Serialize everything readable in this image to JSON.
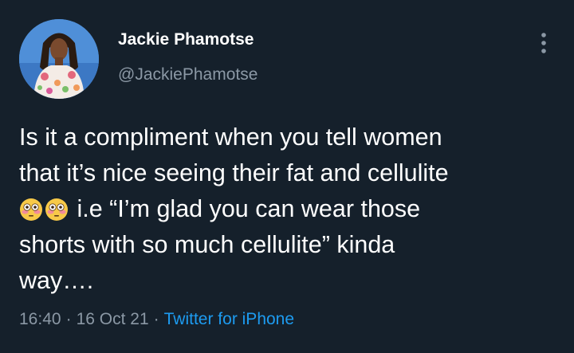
{
  "author": {
    "display_name": "Jackie Phamotse",
    "handle": "@JackiePhamotse"
  },
  "tweet": {
    "lines": [
      "Is it a compliment when you tell women",
      "that it’s nice seeing their fat and cellulite",
      "i.e “I’m glad you can wear those",
      "shorts with so much cellulite” kinda",
      "way…."
    ],
    "emoji": [
      "flushed-face",
      "flushed-face"
    ]
  },
  "meta": {
    "time": "16:40",
    "date": "16 Oct 21",
    "separator": "·",
    "source": "Twitter for iPhone"
  },
  "colors": {
    "background": "#15202b",
    "text_primary": "#ffffff",
    "text_secondary": "#8b98a5",
    "link": "#1d9bf0",
    "emoji_face": "#f7c948"
  },
  "icons": {
    "more": "more-vertical-icon",
    "emoji": "flushed-face-icon"
  }
}
